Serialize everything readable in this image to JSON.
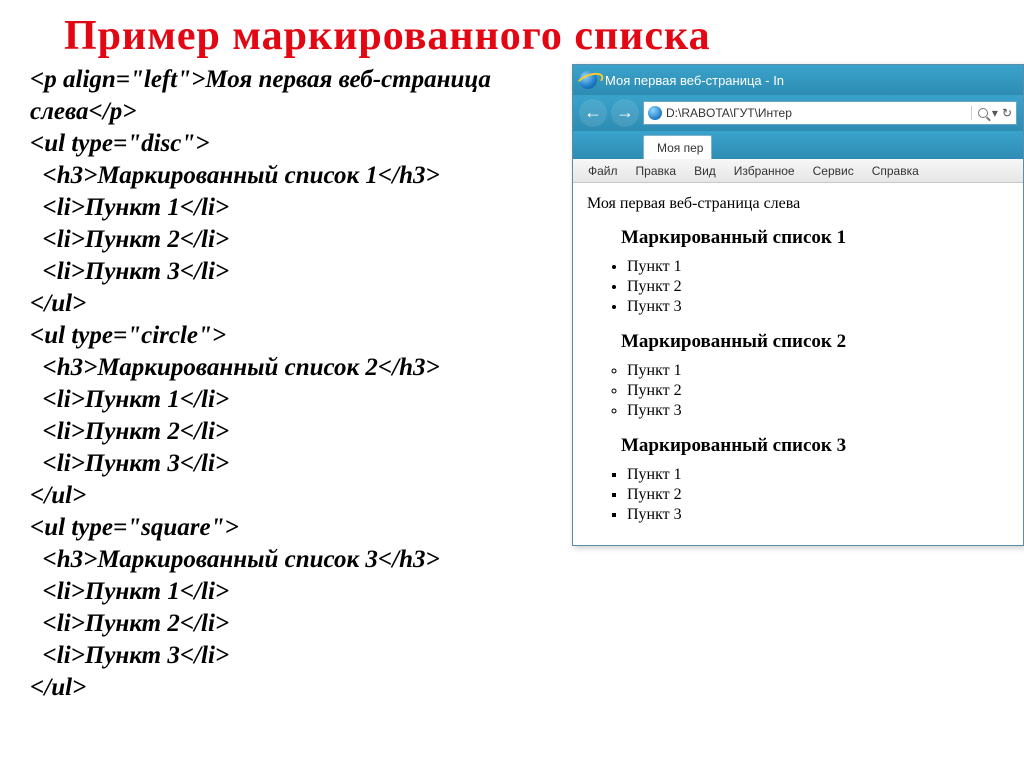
{
  "slide": {
    "title": "Пример  маркированного  списка"
  },
  "code": {
    "lines": [
      "<p align=\"left\">Моя первая веб-страница",
      "слева</p>",
      "<ul type=\"disc\">",
      "  <h3>Маркированный список 1</h3>",
      "  <li>Пункт 1</li>",
      "  <li>Пункт 2</li>",
      "  <li>Пункт 3</li>",
      "</ul>",
      "<ul type=\"circle\">",
      "  <h3>Маркированный список 2</h3>",
      "  <li>Пункт 1</li>",
      "  <li>Пункт 2</li>",
      "  <li>Пункт 3</li>",
      "</ul>",
      "<ul type=\"square\">",
      "  <h3>Маркированный список 3</h3>",
      "  <li>Пункт 1</li>",
      "  <li>Пункт 2</li>",
      "  <li>Пункт 3</li>",
      "</ul>"
    ]
  },
  "browser": {
    "window_title": "Моя первая веб-страница - In",
    "address": "D:\\RABOTA\\ГУТ\\Интер",
    "address_search_hint": "↻",
    "tab_label": "Моя пер",
    "menu": [
      "Файл",
      "Правка",
      "Вид",
      "Избранное",
      "Сервис",
      "Справка"
    ],
    "nav_back_glyph": "←",
    "nav_fwd_glyph": "→",
    "search_suffix": "▾"
  },
  "rendered": {
    "paragraph": "Моя первая веб-страница слева",
    "lists": [
      {
        "heading": "Маркированный список 1",
        "type": "disc",
        "items": [
          "Пункт 1",
          "Пункт 2",
          "Пункт 3"
        ]
      },
      {
        "heading": "Маркированный список 2",
        "type": "circle",
        "items": [
          "Пункт 1",
          "Пункт 2",
          "Пункт 3"
        ]
      },
      {
        "heading": "Маркированный список 3",
        "type": "square",
        "items": [
          "Пункт 1",
          "Пункт 2",
          "Пункт 3"
        ]
      }
    ]
  }
}
